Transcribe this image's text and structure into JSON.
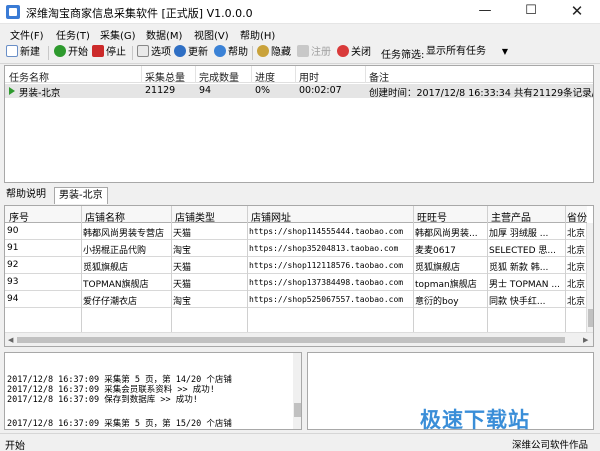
{
  "window": {
    "title": "深维淘宝商家信息采集软件 [正式版] V1.0.0.0",
    "minimize": "—",
    "maximize": "☐",
    "close": "✕"
  },
  "menu": [
    "文件(F)",
    "任务(T)",
    "采集(G)",
    "数据(M)",
    "视图(V)",
    "帮助(H)"
  ],
  "toolbar": {
    "new": "新建",
    "start": "开始",
    "stop": "停止",
    "options": "选项",
    "update": "更新",
    "help": "帮助",
    "hide": "隐藏",
    "register": "注册",
    "close": "关闭",
    "filter_label": "任务筛选:",
    "filter_value": "显示所有任务"
  },
  "task_table": {
    "headers": [
      "任务名称",
      "采集总量",
      "完成数量",
      "进度",
      "用时",
      "备注"
    ],
    "rows": [
      [
        "男装-北京",
        "21129",
        "94",
        "0%",
        "00:02:07",
        "创建时间：2017/12/8 16:33:34 共有21129条记录/..."
      ]
    ]
  },
  "tabs": [
    "帮助说明",
    "男装-北京"
  ],
  "grid": {
    "headers": [
      "序号",
      "店铺名称",
      "店铺类型",
      "店铺网址",
      "旺旺号",
      "主营产品",
      "省份"
    ],
    "rows": [
      [
        "90",
        "韩都风尚男装专营店",
        "天猫",
        "https://shop114555444.taobao.com",
        "韩都风尚男装...",
        "加厚 羽绒服 ...",
        "北京"
      ],
      [
        "91",
        "小拐棍正品代购",
        "淘宝",
        "https://shop35204813.taobao.com",
        "麦麦0617",
        "SELECTED 思...",
        "北京"
      ],
      [
        "92",
        "觅狐旗舰店",
        "天猫",
        "https://shop112118576.taobao.com",
        "觅狐旗舰店",
        "觅狐 新款 韩...",
        "北京"
      ],
      [
        "93",
        "TOPMAN旗舰店",
        "天猫",
        "https://shop137384498.taobao.com",
        "topman旗舰店",
        "男士 TOPMAN ...",
        "北京"
      ],
      [
        "94",
        "爱仔仔潮衣店",
        "淘宝",
        "https://shop525067557.taobao.com",
        "意衍的boy",
        "同款 快手红...",
        "北京"
      ]
    ]
  },
  "log": [
    "2017/12/8 16:37:09 采集第 5 页，第 14/20 个店铺",
    "2017/12/8 16:37:09 采集会员联系资料 >> 成功!",
    "2017/12/8 16:37:09 保存到数据库 >> 成功!",
    "",
    "2017/12/8 16:37:09 采集第 5 页，第 15/20 个店铺"
  ],
  "status": {
    "left": "开始",
    "right": "深维公司软件作品"
  },
  "watermark": "极速下载站",
  "colors": {
    "play_icon": "#2e9a2e",
    "watermark": "#3a8ed8",
    "selected_row": "#e5e5e5"
  }
}
